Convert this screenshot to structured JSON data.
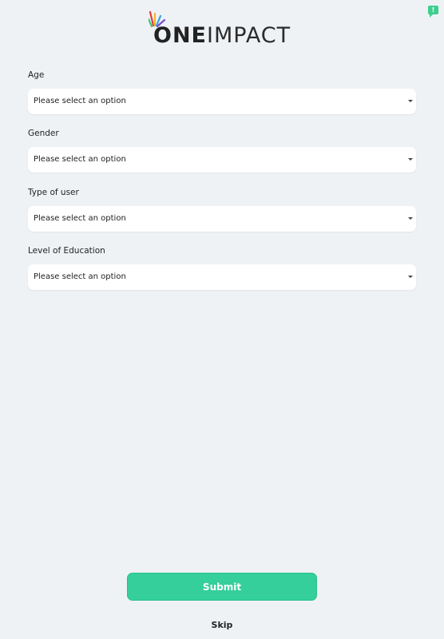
{
  "header": {
    "logo_one": "ONE",
    "logo_impact": "IMPACT"
  },
  "feedback": {
    "badge": "!"
  },
  "form": {
    "fields": [
      {
        "label": "Age",
        "value": "Please select an option"
      },
      {
        "label": "Gender",
        "value": "Please select an option"
      },
      {
        "label": "Type of user",
        "value": "Please select an option"
      },
      {
        "label": "Level of Education",
        "value": "Please select an option"
      }
    ]
  },
  "actions": {
    "submit_label": "Submit",
    "skip_label": "Skip"
  },
  "colors": {
    "background": "#eef2f5",
    "accent": "#34cf9a"
  }
}
